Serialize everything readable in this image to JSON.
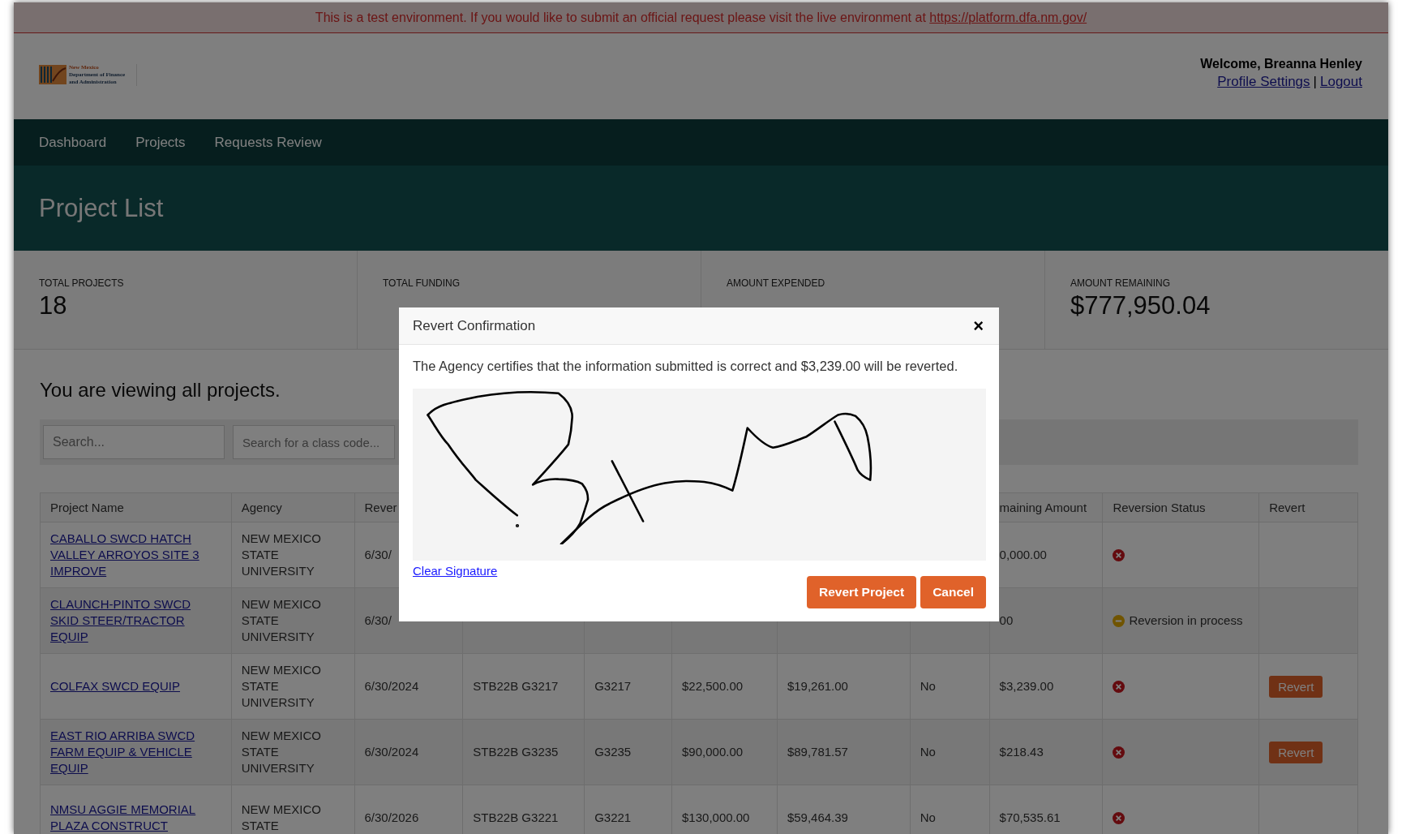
{
  "banner": {
    "text": "This is a test environment. If you would like to submit an official request please visit the live environment at",
    "link": "https://platform.dfa.nm.gov/"
  },
  "header": {
    "logo_lines": [
      "New Mexico",
      "Department of Finance",
      "and Administration"
    ],
    "welcome": "Welcome, Breanna Henley",
    "links": [
      "Profile Settings",
      "Logout"
    ],
    "separator": "|"
  },
  "nav": [
    "Dashboard",
    "Projects",
    "Requests Review"
  ],
  "page_title": "Project List",
  "stats": [
    {
      "label": "TOTAL PROJECTS",
      "value": "18"
    },
    {
      "label": "TOTAL FUNDING"
    },
    {
      "label": "AMOUNT EXPENDED"
    },
    {
      "label": "AMOUNT REMAINING",
      "value": "$777,950.04"
    }
  ],
  "viewing": "You are viewing all projects.",
  "filters": [
    {
      "placeholder": "Search..."
    },
    {
      "placeholder": "Search for a class code..."
    }
  ],
  "table": {
    "columns": [
      {
        "label": "Project Name"
      },
      {
        "label": "Agency"
      },
      {
        "label": "Rever"
      },
      {},
      {},
      {},
      {},
      {},
      {
        "label": "maining Amount"
      },
      {
        "label": "Reversion Status"
      },
      {
        "label": "Revert"
      }
    ],
    "rows": [
      {
        "cells": [
          "CABALLO SWCD HATCH VALLEY ARROYOS SITE 3 IMPROVE",
          "NEW MEXICO STATE UNIVERSITY",
          "6/30/",
          null,
          null,
          null,
          null,
          null,
          "0,000.00"
        ],
        "status": {
          "kind": "none"
        }
      },
      {
        "cells": [
          "CLAUNCH-PINTO SWCD SKID STEER/TRACTOR EQUIP",
          "NEW MEXICO STATE UNIVERSITY",
          "6/30/",
          null,
          null,
          null,
          null,
          null,
          "00"
        ],
        "status": {
          "kind": "in_process",
          "text": "Reversion in process"
        }
      },
      {
        "cells": [
          "COLFAX SWCD EQUIP",
          "NEW MEXICO STATE UNIVERSITY",
          "6/30/2024",
          "STB22B G3217",
          "G3217",
          "$22,500.00",
          "$19,261.00",
          "No",
          "$3,239.00"
        ],
        "status": {
          "kind": "none"
        },
        "revert": "Revert"
      },
      {
        "cells": [
          "EAST RIO ARRIBA SWCD FARM EQUIP & VEHICLE EQUIP",
          "NEW MEXICO STATE UNIVERSITY",
          "6/30/2024",
          "STB22B G3235",
          "G3235",
          "$90,000.00",
          "$89,781.57",
          "No",
          "$218.43"
        ],
        "status": {
          "kind": "none"
        },
        "revert": "Revert"
      },
      {
        "cells": [
          "NMSU AGGIE MEMORIAL PLAZA CONSTRUCT",
          "NEW MEXICO STATE",
          "6/30/2026",
          "STB22B G3221",
          "G3221",
          "$130,000.00",
          "$59,464.39",
          "No",
          "$70,535.61"
        ],
        "status": {
          "kind": "none"
        }
      }
    ]
  },
  "modal": {
    "title": "Revert Confirmation",
    "close": "×",
    "message": "The Agency certifies that the information submitted is correct and $3,239.00 will be reverted.",
    "clear_link": "Clear Signature",
    "buttons": [
      "Revert Project",
      "Cancel"
    ]
  }
}
